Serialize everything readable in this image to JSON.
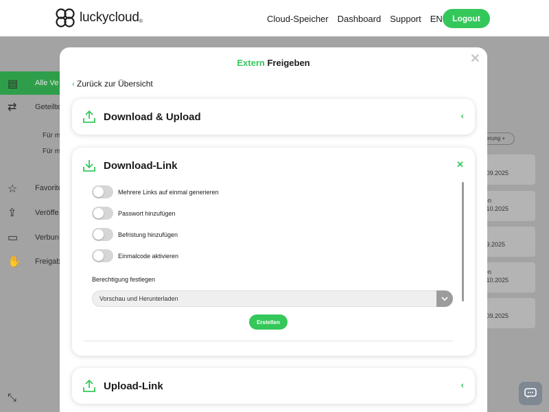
{
  "header": {
    "logo_text": "luckycloud",
    "logo_mark": "®",
    "nav": [
      "Cloud-Speicher",
      "Dashboard",
      "Support",
      "EN"
    ],
    "logout_label": "Logout"
  },
  "background": {
    "sidebar": {
      "items": [
        {
          "label": "Alle Ve",
          "icon": "folder-icon"
        },
        {
          "label": "Geteilte",
          "icon": "shared-users-icon"
        },
        {
          "label": "Favorite",
          "icon": "star-icon"
        },
        {
          "label": "Veröffe",
          "icon": "publish-icon"
        },
        {
          "label": "Verbun",
          "icon": "monitor-icon"
        },
        {
          "label": "Freigab",
          "icon": "handshake-icon"
        }
      ],
      "subitems": [
        "Für m",
        "Für m"
      ]
    },
    "filter_pill": "lerung +",
    "dates": [
      ".09.2025",
      "en",
      ".10.2025",
      ".9.2025",
      "en",
      ".10.2025",
      ".09.2025"
    ]
  },
  "modal": {
    "title_accent": "Extern",
    "title_rest": "Freigeben",
    "back_label": "Zurück zur Übersicht",
    "sections": {
      "download_upload": {
        "title": "Download & Upload",
        "icon": "upload-icon",
        "action_icon": "chevron-left-icon"
      },
      "download_link": {
        "title": "Download-Link",
        "icon": "download-icon",
        "action_icon": "close-icon",
        "toggles": [
          "Mehrere Links auf einmal generieren",
          "Passwort hinzufügen",
          "Befristung hinzufügen",
          "Einmalcode aktivieren"
        ],
        "permission_label": "Berechtigung festlegen",
        "permission_value": "Vorschau und Herunterladen",
        "create_label": "Erstellen"
      },
      "upload_link": {
        "title": "Upload-Link",
        "icon": "upload-icon",
        "action_icon": "chevron-left-icon"
      }
    }
  },
  "colors": {
    "accent": "#34c75a",
    "overlay": "#a3a3a3"
  }
}
